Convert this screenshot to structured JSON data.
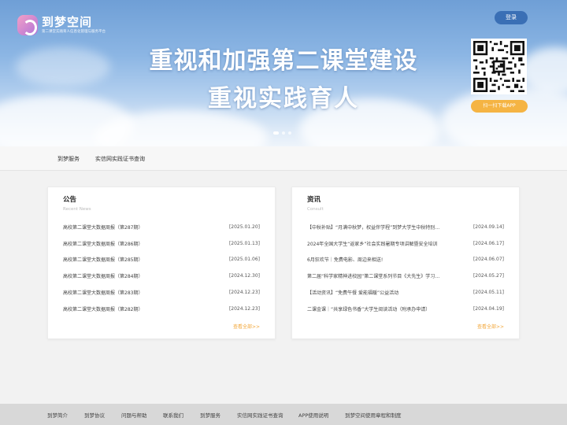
{
  "header": {
    "logo_title": "到梦空间",
    "logo_subtitle": "第二课堂实践育人信息化管理与服务平台",
    "login_label": "登录",
    "slogan_line1": "重视和加强第二课堂建设",
    "slogan_line2": "重视实践育人",
    "download_label": "扫一扫下载APP"
  },
  "nav": {
    "items": [
      {
        "label": "到梦服务"
      },
      {
        "label": "实信网实践证书查询"
      }
    ]
  },
  "announcements": {
    "title": "公告",
    "subtitle": "Recent News",
    "more_label": "查看全部>>",
    "items": [
      {
        "title": "高校第二课堂大数据周报（第287期）",
        "date": "[2025.01.20]"
      },
      {
        "title": "高校第二课堂大数据周报（第286期）",
        "date": "[2025.01.13]"
      },
      {
        "title": "高校第二课堂大数据周报（第285期）",
        "date": "[2025.01.06]"
      },
      {
        "title": "高校第二课堂大数据周报（第284期）",
        "date": "[2024.12.30]"
      },
      {
        "title": "高校第二课堂大数据周报（第283期）",
        "date": "[2024.12.23]"
      },
      {
        "title": "高校第二课堂大数据周报（第282期）",
        "date": "[2024.12.23]"
      }
    ]
  },
  "news": {
    "title": "资讯",
    "subtitle": "Consult",
    "more_label": "查看全部>>",
    "items": [
      {
        "title": "【中秋补贴】“月满中秋梦，权益伴学程”到梦大学生中秋特别…",
        "date": "[2024.09.14]"
      },
      {
        "title": "2024年全国大学生“返家乡”社会实践暑期专项讲解暨安全培训",
        "date": "[2024.06.17]"
      },
      {
        "title": "6月狂欢节｜免费电影、周边来相送!",
        "date": "[2024.06.07]"
      },
      {
        "title": "第二届“科学家精神进校园”第二课堂系列节目《大先生》学习…",
        "date": "[2024.05.27]"
      },
      {
        "title": "【活动资讯】“免费午餐 爱能福暖”公益活动",
        "date": "[2024.05.11]"
      },
      {
        "title": "二课金课｜“共享绿色书香”大学生阅读活动（附承办申请）",
        "date": "[2024.04.19]"
      }
    ]
  },
  "footer": {
    "links": [
      {
        "label": "到梦简介"
      },
      {
        "label": "到梦协议"
      },
      {
        "label": "问题与帮助"
      },
      {
        "label": "联系我们"
      },
      {
        "label": "到梦服务"
      },
      {
        "label": "实信网实践证书查询"
      },
      {
        "label": "APP使用说明"
      },
      {
        "label": "到梦空间使用章程和制度"
      }
    ]
  },
  "colors": {
    "accent": "#3a6fb5",
    "download_button": "#f5b443",
    "more_link": "#f2a73a"
  }
}
